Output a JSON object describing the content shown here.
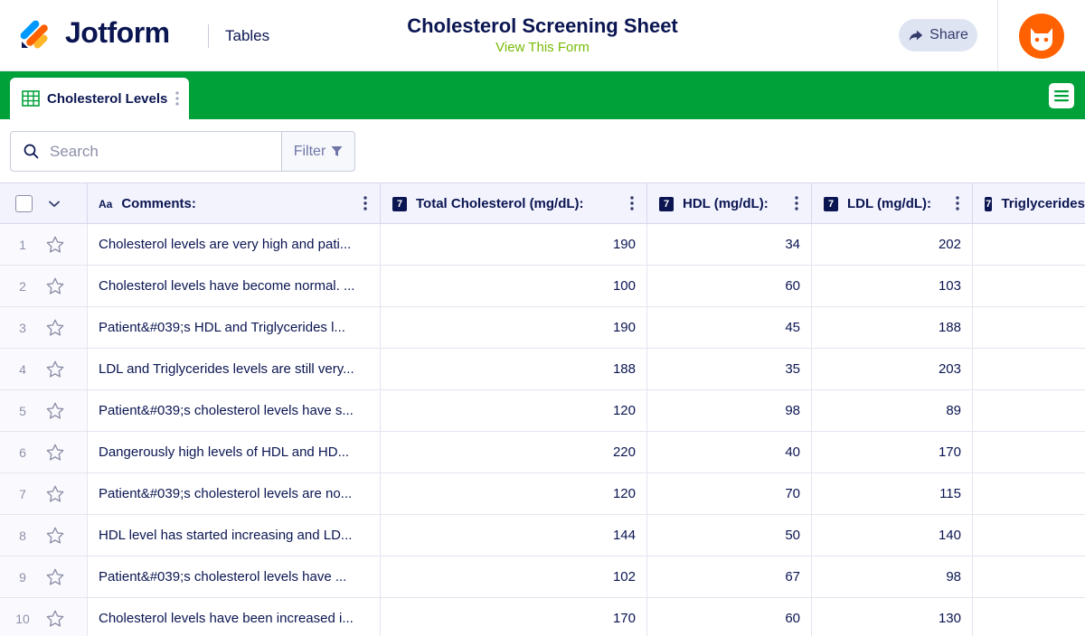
{
  "header": {
    "brand": "Jotform",
    "section": "Tables",
    "form_title": "Cholesterol Screening Sheet",
    "form_link": "View This Form",
    "share_label": "Share",
    "brand_colors": {
      "navy": "#0a1551",
      "green": "#01a13a",
      "orange": "#ff6100",
      "link": "#78bb07"
    }
  },
  "tabs": [
    {
      "label": "Cholesterol Levels",
      "icon": "table-grid-icon"
    }
  ],
  "search": {
    "placeholder": "Search",
    "filter_label": "Filter"
  },
  "table": {
    "columns": [
      {
        "type": "Aa",
        "label": "Comments:"
      },
      {
        "type": "7",
        "label": "Total Cholesterol (mg/dL):"
      },
      {
        "type": "7",
        "label": "HDL (mg/dL):"
      },
      {
        "type": "7",
        "label": "LDL (mg/dL):"
      },
      {
        "type": "7",
        "label": "Triglycerides"
      }
    ],
    "rows": [
      {
        "n": "1",
        "comment": "Cholesterol levels are very high and pati...",
        "total": "190",
        "hdl": "34",
        "ldl": "202"
      },
      {
        "n": "2",
        "comment": "Cholesterol levels have become normal. ...",
        "total": "100",
        "hdl": "60",
        "ldl": "103"
      },
      {
        "n": "3",
        "comment": "Patient&#039;s HDL and Triglycerides l...",
        "total": "190",
        "hdl": "45",
        "ldl": "188"
      },
      {
        "n": "4",
        "comment": "LDL and Triglycerides levels are still very...",
        "total": "188",
        "hdl": "35",
        "ldl": "203"
      },
      {
        "n": "5",
        "comment": "Patient&#039;s cholesterol levels have s...",
        "total": "120",
        "hdl": "98",
        "ldl": "89"
      },
      {
        "n": "6",
        "comment": "Dangerously high levels of HDL and HD...",
        "total": "220",
        "hdl": "40",
        "ldl": "170"
      },
      {
        "n": "7",
        "comment": "Patient&#039;s cholesterol levels are no...",
        "total": "120",
        "hdl": "70",
        "ldl": "115"
      },
      {
        "n": "8",
        "comment": "HDL level has started increasing and LD...",
        "total": "144",
        "hdl": "50",
        "ldl": "140"
      },
      {
        "n": "9",
        "comment": "Patient&#039;s cholesterol levels have ...",
        "total": "102",
        "hdl": "67",
        "ldl": "98"
      },
      {
        "n": "10",
        "comment": "Cholesterol levels have been increased i...",
        "total": "170",
        "hdl": "60",
        "ldl": "130"
      }
    ]
  }
}
